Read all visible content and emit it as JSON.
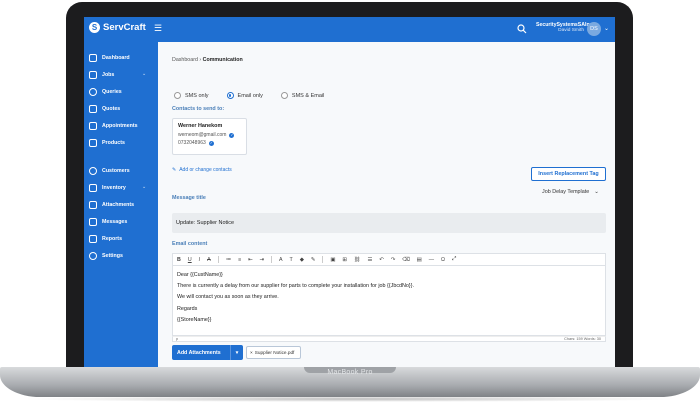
{
  "device": {
    "brand_label": "MacBook Pro"
  },
  "app": {
    "name": "ServCraft",
    "colors": {
      "accent": "#1f6fd1",
      "sidebar": "#1f6fd1",
      "link": "#4a7fb8"
    }
  },
  "header": {
    "company": "SecuritySystemsSAInc",
    "user_name": "David Smith",
    "avatar_initials": "DS"
  },
  "sidebar": {
    "items": [
      {
        "label": "Dashboard",
        "icon": "home-icon"
      },
      {
        "label": "Jobs",
        "icon": "document-icon",
        "has_chevron": true
      },
      {
        "label": "Queries",
        "icon": "question-icon"
      },
      {
        "label": "Quotes",
        "icon": "document-icon"
      },
      {
        "label": "Appointments",
        "icon": "calendar-icon"
      },
      {
        "label": "Products",
        "icon": "box-icon"
      },
      {
        "label": "Customers",
        "icon": "users-icon"
      },
      {
        "label": "Inventory",
        "icon": "cube-icon",
        "has_chevron": true
      },
      {
        "label": "Attachments",
        "icon": "paperclip-icon"
      },
      {
        "label": "Messages",
        "icon": "mail-icon"
      },
      {
        "label": "Reports",
        "icon": "report-icon"
      },
      {
        "label": "Settings",
        "icon": "gear-icon"
      }
    ]
  },
  "breadcrumb": {
    "root": "Dashboard",
    "separator": "›",
    "current": "Communication"
  },
  "send_mode": {
    "options": [
      "SMS only",
      "Email only",
      "SMS & Email"
    ],
    "selected": "Email only"
  },
  "contacts": {
    "label": "Contacts to send to:",
    "contact_name": "Werner Hanekom",
    "email": "werneom@gmail.com",
    "phone": "0732048963",
    "add_link": "Add or change contacts"
  },
  "insert_button": "Insert Replacement Tag",
  "message_title": {
    "label": "Message title",
    "template": "Job Delay Template",
    "value": "Update: Supplier Notice"
  },
  "email_content": {
    "label": "Email content",
    "lines": [
      "Dear {{CustName}}",
      "There is currently a delay from our supplier for parts to complete your installation for job {{JbcdNo}}.",
      "We will contact you as soon as they arrive.",
      "Regards",
      "{{StoreName}}"
    ],
    "path": "p",
    "counts": "Chars: 159  Words: 30"
  },
  "attachments": {
    "button": "Add Attachments",
    "file": "Supplier Notice.pdf"
  }
}
